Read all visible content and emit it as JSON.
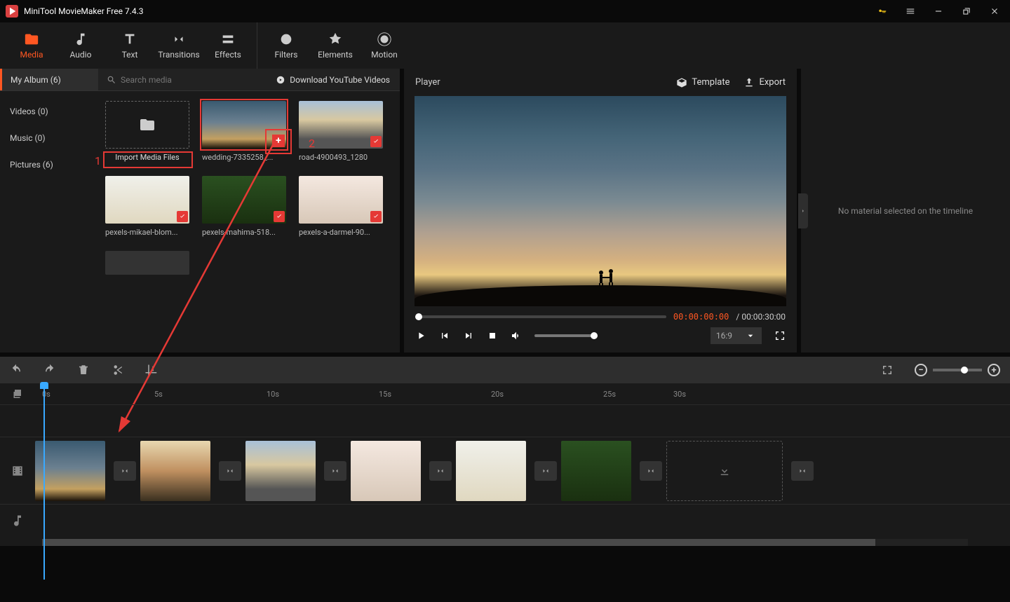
{
  "app": {
    "title": "MiniTool MovieMaker Free 7.4.3"
  },
  "topnav": {
    "media": "Media",
    "audio": "Audio",
    "text": "Text",
    "transitions": "Transitions",
    "effects": "Effects",
    "filters": "Filters",
    "elements": "Elements",
    "motion": "Motion"
  },
  "media": {
    "album_label": "My Album (6)",
    "search_placeholder": "Search media",
    "download_label": "Download YouTube Videos",
    "sidebar": {
      "videos": "Videos (0)",
      "music": "Music (0)",
      "pictures": "Pictures (6)"
    },
    "import_label": "Import Media Files",
    "tiles": {
      "t1": "wedding-7335258_...",
      "t2": "road-4900493_1280",
      "t3": "pexels-mikael-blom...",
      "t4": "pexels-mahima-518...",
      "t5": "pexels-a-darmel-90..."
    }
  },
  "callouts": {
    "one": "1",
    "two": "2"
  },
  "player": {
    "title": "Player",
    "template": "Template",
    "export": "Export",
    "cur": "00:00:00:00",
    "sep": " / ",
    "dur": "00:00:30:00",
    "aspect": "16:9"
  },
  "right_panel": {
    "msg": "No material selected on the timeline"
  },
  "timeline": {
    "ticks": [
      "0s",
      "5s",
      "10s",
      "15s",
      "20s",
      "25s",
      "30s"
    ]
  }
}
